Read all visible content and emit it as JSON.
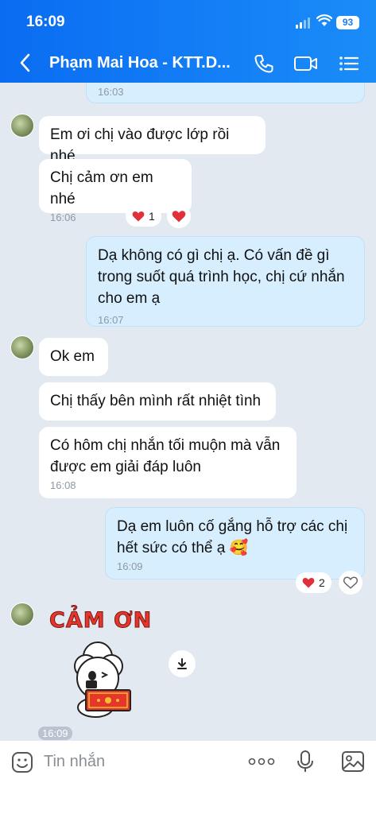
{
  "status_bar": {
    "time": "16:09",
    "battery": "93"
  },
  "header": {
    "title": "Phạm Mai Hoa - KTT.D..."
  },
  "messages": [
    {
      "time": "16:03"
    },
    {
      "text": "Em ơi chị vào được lớp rồi nhé"
    },
    {
      "text": "Chị cảm ơn em nhé",
      "time": "16:06",
      "reaction_count": "1"
    },
    {
      "text": "Dạ không có gì chị ạ. Có vấn đề gì trong suốt quá trình học, chị cứ nhắn cho em ạ",
      "time": "16:07"
    },
    {
      "text": "Ok em"
    },
    {
      "text": "Chị thấy bên mình rất nhiệt tình"
    },
    {
      "text": "Có hôm chị nhắn tối muộn mà vẫn được em giải đáp luôn",
      "time": "16:08"
    },
    {
      "text": "Dạ em luôn cố gắng hỗ trợ các chị hết sức có thể ạ 🥰",
      "time": "16:09",
      "reaction_count": "2"
    }
  ],
  "sticker": {
    "text": "CẢM ƠN",
    "time": "16:09"
  },
  "input": {
    "placeholder": "Tin nhắn"
  },
  "colors": {
    "header": "#1a7cf5",
    "outgoing_bubble": "#d6eefe",
    "incoming_bubble": "#ffffff",
    "background": "#e2e9f1",
    "heart": "#e0303a"
  },
  "icons": [
    "back-icon",
    "phone-icon",
    "video-icon",
    "menu-icon",
    "heart-icon",
    "download-icon",
    "sticker-icon",
    "more-icon",
    "mic-icon",
    "image-icon"
  ]
}
